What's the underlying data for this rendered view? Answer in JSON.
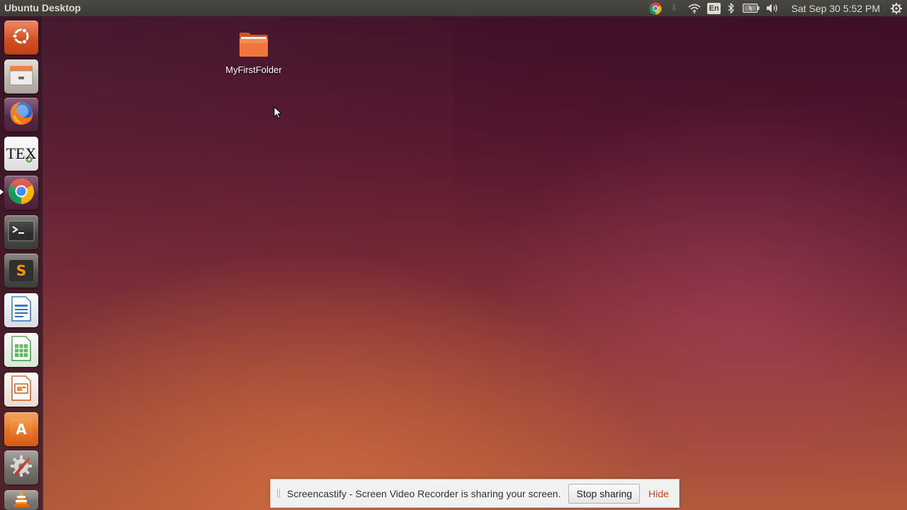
{
  "top_panel": {
    "title": "Ubuntu Desktop",
    "indicators": {
      "chrome": "chrome-indicator-icon",
      "network": "wifi-icon",
      "keyboard_layout": "En",
      "bluetooth": "bluetooth-icon",
      "battery": "battery-icon",
      "sound": "volume-icon",
      "clock": "Sat Sep 30  5:52 PM",
      "session": "gear-icon"
    }
  },
  "launcher": {
    "items": [
      {
        "name": "dash",
        "icon": "ubuntu-dash-icon"
      },
      {
        "name": "files",
        "icon": "files-icon"
      },
      {
        "name": "firefox",
        "icon": "firefox-icon"
      },
      {
        "name": "texmaker",
        "icon": "tex-icon",
        "label": "TEX"
      },
      {
        "name": "chrome",
        "icon": "chrome-icon",
        "running": true
      },
      {
        "name": "terminal",
        "icon": "terminal-icon"
      },
      {
        "name": "sublime-text",
        "icon": "sublime-text-icon",
        "label": "S"
      },
      {
        "name": "libreoffice-writer",
        "icon": "writer-icon"
      },
      {
        "name": "libreoffice-calc",
        "icon": "calc-icon"
      },
      {
        "name": "libreoffice-impress",
        "icon": "impress-icon"
      },
      {
        "name": "software-center",
        "icon": "software-center-icon",
        "label": "A"
      },
      {
        "name": "system-settings",
        "icon": "settings-icon"
      },
      {
        "name": "vlc",
        "icon": "vlc-icon"
      }
    ]
  },
  "desktop": {
    "icons": [
      {
        "label": "MyFirstFolder",
        "icon": "folder-icon"
      }
    ]
  },
  "share_bar": {
    "message": "Screencastify - Screen Video Recorder is sharing your screen.",
    "stop_label": "Stop sharing",
    "hide_label": "Hide"
  },
  "colors": {
    "panel": "#3c3b37",
    "launcher": "#34162a",
    "wallpaper_top": "#3e1028",
    "wallpaper_bottom": "#b35a3c",
    "hide_link": "#c5471f"
  }
}
